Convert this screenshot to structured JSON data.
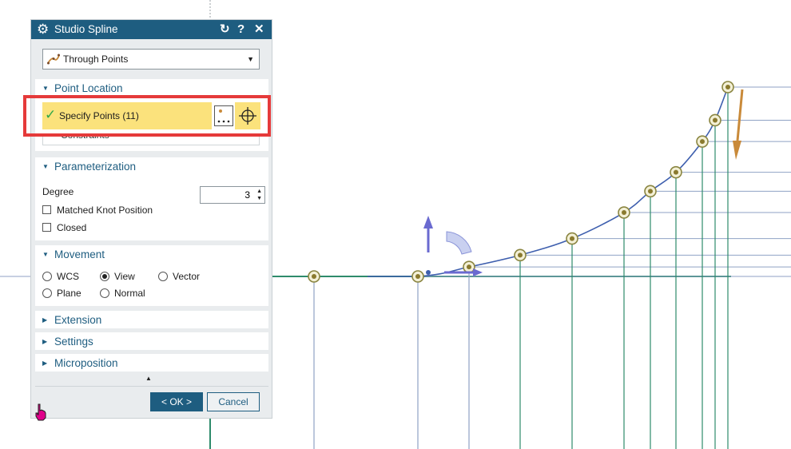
{
  "dialog": {
    "title": "Studio Spline",
    "reset_icon": "↻",
    "help_icon": "?",
    "close_icon": "✕",
    "type_dropdown": {
      "selected": "Through Points"
    },
    "point_location": {
      "title": "Point Location",
      "specify_points": "Specify Points (11)",
      "constraints": "Constraints"
    },
    "parameterization": {
      "title": "Parameterization",
      "degree_label": "Degree",
      "degree_value": "3",
      "matched_knot_label": "Matched Knot Position",
      "closed_label": "Closed"
    },
    "movement": {
      "title": "Movement",
      "options": [
        "WCS",
        "View",
        "Vector",
        "Plane",
        "Normal"
      ],
      "selected": "View"
    },
    "extension": {
      "title": "Extension"
    },
    "settings": {
      "title": "Settings"
    },
    "microposition": {
      "title": "Microposition"
    },
    "ok_label": "< OK >",
    "cancel_label": "Cancel"
  },
  "colors": {
    "titlebar": "#1e5d80",
    "highlight": "#e53a3a",
    "selection": "#fbe27c",
    "spline": "#3e5fae",
    "construction_green": "#2e8b6b",
    "construction_blue": "#8fa2c4",
    "handle_brown": "#c98a3a"
  },
  "spline_points": [
    {
      "x": 0,
      "y": 0
    },
    {
      "x": 1,
      "y": 0
    },
    {
      "x": 2,
      "y": 0.4
    },
    {
      "x": 3,
      "y": 0.9
    },
    {
      "x": 4,
      "y": 1.6
    },
    {
      "x": 5,
      "y": 2.7
    },
    {
      "x": 6,
      "y": 3.6
    },
    {
      "x": 7,
      "y": 4.4
    },
    {
      "x": 8,
      "y": 5.7
    },
    {
      "x": 9,
      "y": 6.6
    },
    {
      "x": 10,
      "y": 8.0
    }
  ]
}
